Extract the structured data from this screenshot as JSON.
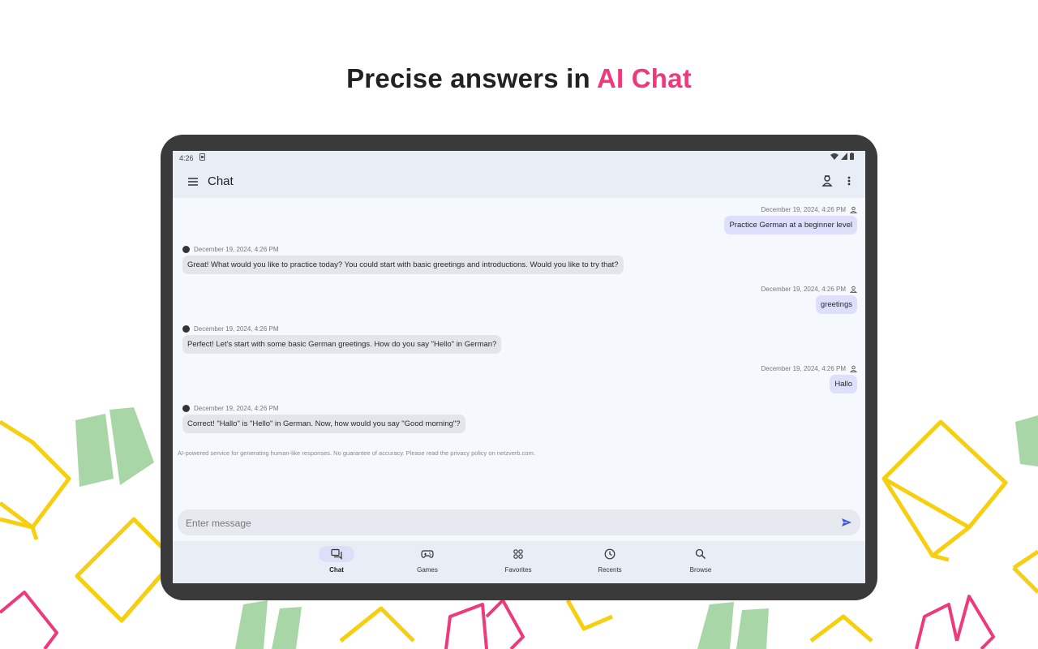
{
  "headline": {
    "prefix": "Precise answers in ",
    "accent": "AI Chat"
  },
  "colors": {
    "accent": "#ee3a7a",
    "user_bubble": "#dee0fb",
    "ai_bubble": "#e3e5ea",
    "bar": "#e9edf5",
    "book_yellow": "#f5cf10",
    "book_green": "#a9d6a6",
    "book_pink": "#ee3a7a"
  },
  "statusbar": {
    "time": "4:26"
  },
  "appbar": {
    "title": "Chat",
    "icons": [
      "menu-icon",
      "account-icon",
      "more-vert-icon"
    ]
  },
  "messages": [
    {
      "role": "user",
      "timestamp": "December 19, 2024, 4:26 PM",
      "text": "Practice German at a beginner level"
    },
    {
      "role": "ai",
      "timestamp": "December 19, 2024, 4:26 PM",
      "text": "Great! What would you like to practice today? You could start with basic greetings and introductions. Would you like to try that?"
    },
    {
      "role": "user",
      "timestamp": "December 19, 2024, 4:26 PM",
      "text": "greetings"
    },
    {
      "role": "ai",
      "timestamp": "December 19, 2024, 4:26 PM",
      "text": "Perfect! Let's start with some basic German greetings. How do you say \"Hello\" in German?"
    },
    {
      "role": "user",
      "timestamp": "December 19, 2024, 4:26 PM",
      "text": "Hallo"
    },
    {
      "role": "ai",
      "timestamp": "December 19, 2024, 4:26 PM",
      "text": "Correct! \"Hallo\" is \"Hello\" in German. Now, how would you say \"Good morning\"?"
    }
  ],
  "disclaimer": "AI-powered service for generating human-like responses. No guarantee of accuracy. Please read the privacy policy on netzverb.com.",
  "input": {
    "placeholder": "Enter message",
    "value": ""
  },
  "nav": [
    {
      "label": "Chat",
      "icon": "chat-icon",
      "active": true
    },
    {
      "label": "Games",
      "icon": "gamepad-icon",
      "active": false
    },
    {
      "label": "Favorites",
      "icon": "grid-icon",
      "active": false
    },
    {
      "label": "Recents",
      "icon": "clock-icon",
      "active": false
    },
    {
      "label": "Browse",
      "icon": "search-icon",
      "active": false
    }
  ]
}
